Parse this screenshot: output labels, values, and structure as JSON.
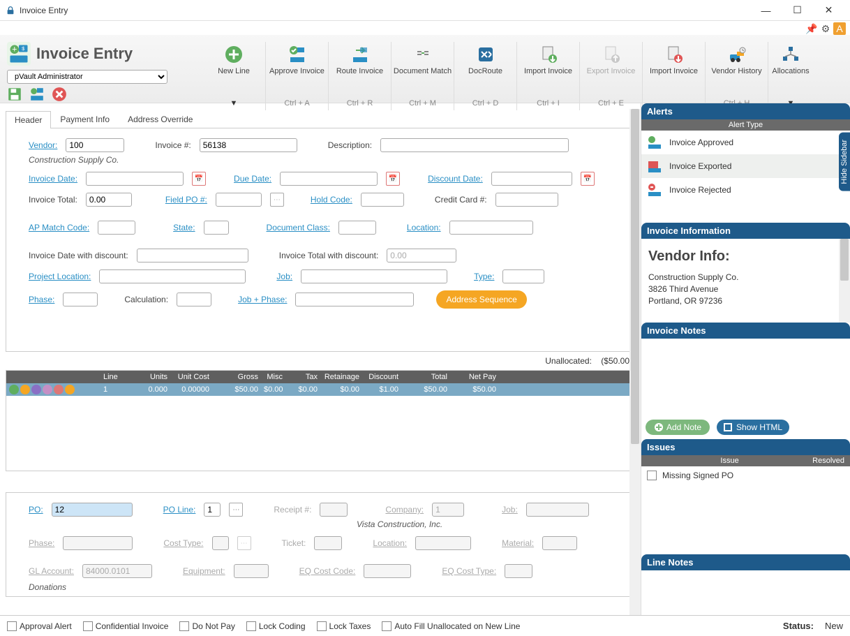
{
  "window": {
    "title": "Invoice Entry"
  },
  "page": {
    "title": "Invoice Entry",
    "user": "pVault Administrator"
  },
  "ribbon": {
    "new_line": {
      "label": "New Line"
    },
    "approve": {
      "label": "Approve Invoice",
      "shortcut": "Ctrl + A"
    },
    "route": {
      "label": "Route Invoice",
      "shortcut": "Ctrl + R"
    },
    "doc_match": {
      "label": "Document Match",
      "shortcut": "Ctrl + M"
    },
    "docroute": {
      "label": "DocRoute",
      "shortcut": "Ctrl + D"
    },
    "import1": {
      "label": "Import Invoice",
      "shortcut": "Ctrl + I"
    },
    "export": {
      "label": "Export Invoice",
      "shortcut": "Ctrl + E"
    },
    "import2": {
      "label": "Import Invoice"
    },
    "vendor_hist": {
      "label": "Vendor History",
      "shortcut": "Ctrl + H"
    },
    "allocations": {
      "label": "Allocations"
    }
  },
  "tabs": {
    "header": "Header",
    "payment_info": "Payment Info",
    "address_override": "Address Override"
  },
  "form": {
    "vendor_label": "Vendor:",
    "vendor_value": "100",
    "vendor_name": "Construction Supply Co.",
    "invoice_num_label": "Invoice #:",
    "invoice_num_value": "56138",
    "description_label": "Description:",
    "description_value": "",
    "invoice_date_label": "Invoice Date:",
    "due_date_label": "Due Date:",
    "discount_date_label": "Discount Date:",
    "invoice_total_label": "Invoice Total:",
    "invoice_total_value": "0.00",
    "field_po_label": "Field PO #:",
    "hold_code_label": "Hold Code:",
    "credit_card_label": "Credit Card #:",
    "ap_match_label": "AP Match Code:",
    "state_label": "State:",
    "doc_class_label": "Document Class:",
    "location_label": "Location:",
    "inv_date_disc_label": "Invoice Date with discount:",
    "inv_total_disc_label": "Invoice Total with discount:",
    "inv_total_disc_value": "0.00",
    "project_loc_label": "Project Location:",
    "job_label": "Job:",
    "type_label": "Type:",
    "phase_label": "Phase:",
    "calc_label": "Calculation:",
    "job_phase_label": "Job + Phase:",
    "addr_seq_btn": "Address Sequence"
  },
  "unallocated": {
    "label": "Unallocated:",
    "value": "($50.00)"
  },
  "grid": {
    "headers": {
      "line": "Line",
      "units": "Units",
      "unit_cost": "Unit Cost",
      "gross": "Gross",
      "misc": "Misc",
      "tax": "Tax",
      "retainage": "Retainage",
      "discount": "Discount",
      "total": "Total",
      "net_pay": "Net Pay"
    },
    "row1": {
      "line": "1",
      "units": "0.000",
      "unit_cost": "0.00000",
      "gross": "$50.00",
      "misc": "$0.00",
      "tax": "$0.00",
      "retainage": "$0.00",
      "discount": "$1.00",
      "total": "$50.00",
      "net_pay": "$50.00"
    }
  },
  "lower": {
    "po_label": "PO:",
    "po_value": "12",
    "po_line_label": "PO Line:",
    "po_line_value": "1",
    "receipt_label": "Receipt #:",
    "company_label": "Company:",
    "company_value": "1",
    "company_name": "Vista Construction, Inc.",
    "job_label": "Job:",
    "phase_label": "Phase:",
    "cost_type_label": "Cost Type:",
    "ticket_label": "Ticket:",
    "location_label": "Location:",
    "material_label": "Material:",
    "gl_label": "GL Account:",
    "gl_value": "84000.0101",
    "gl_name": "Donations",
    "equipment_label": "Equipment:",
    "eq_cost_code_label": "EQ Cost Code:",
    "eq_cost_type_label": "EQ Cost Type:"
  },
  "alerts": {
    "title": "Alerts",
    "type_header": "Alert Type",
    "items": [
      {
        "label": "Invoice Approved"
      },
      {
        "label": "Invoice Exported"
      },
      {
        "label": "Invoice Rejected"
      }
    ]
  },
  "invoice_info": {
    "title": "Invoice Information",
    "vendor_info_title": "Vendor Info:",
    "vendor_name": "Construction Supply Co.",
    "vendor_addr1": "3826 Third Avenue",
    "vendor_addr2": "Portland, OR 97236"
  },
  "notes": {
    "title": "Invoice Notes",
    "add_note": "Add Note",
    "show_html": "Show HTML"
  },
  "issues": {
    "title": "Issues",
    "col_issue": "Issue",
    "col_resolved": "Resolved",
    "items": [
      {
        "label": "Missing Signed PO"
      }
    ]
  },
  "line_notes": {
    "title": "Line Notes"
  },
  "sidebar_tab": "Hide Sidebar",
  "bottom": {
    "approval_alert": "Approval Alert",
    "confidential": "Confidential Invoice",
    "do_not_pay": "Do Not Pay",
    "lock_coding": "Lock Coding",
    "lock_taxes": "Lock Taxes",
    "auto_fill": "Auto Fill Unallocated on New Line",
    "status_label": "Status:",
    "status_value": "New"
  }
}
